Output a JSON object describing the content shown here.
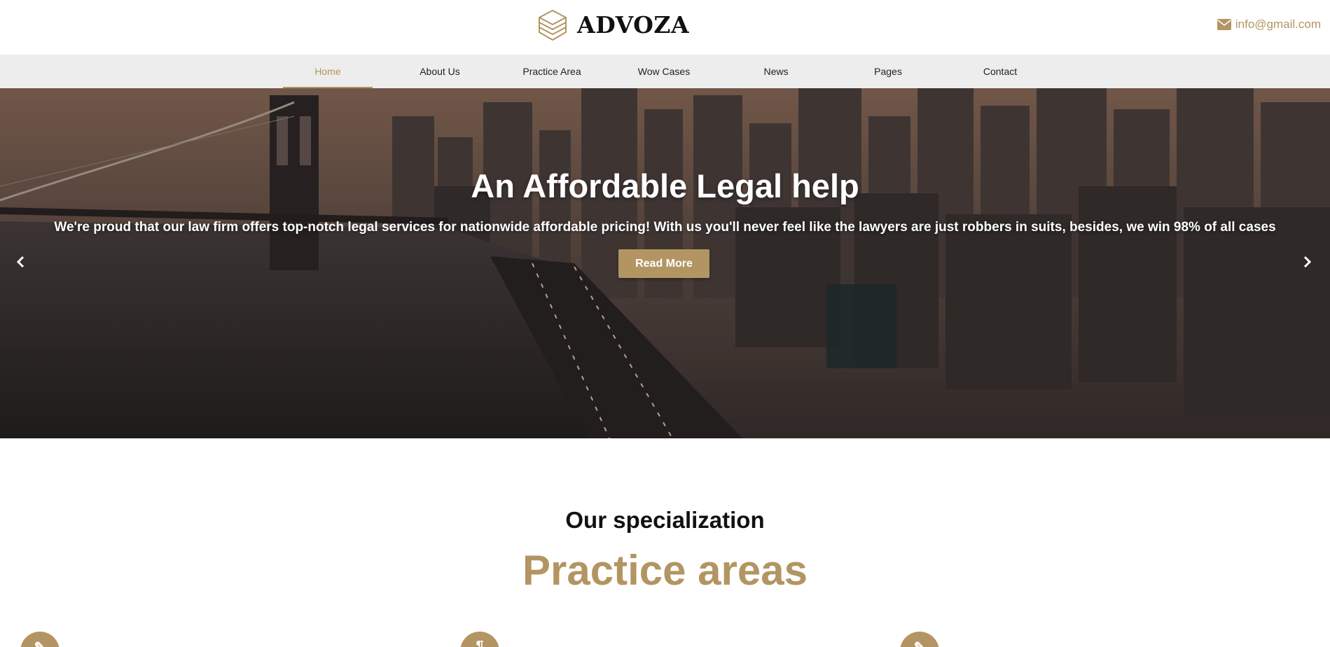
{
  "brand": {
    "name": "ADVOZA",
    "logo_icon": "stacked-layers-icon"
  },
  "header": {
    "email": "info@gmail.com",
    "email_icon": "envelope-icon"
  },
  "nav": {
    "items": [
      {
        "label": "Home",
        "active": true
      },
      {
        "label": "About Us",
        "active": false
      },
      {
        "label": "Practice Area",
        "active": false
      },
      {
        "label": "Wow Cases",
        "active": false
      },
      {
        "label": "News",
        "active": false
      },
      {
        "label": "Pages",
        "active": false
      },
      {
        "label": "Contact",
        "active": false
      }
    ]
  },
  "hero": {
    "title": "An Affordable Legal help",
    "subtitle": "We're proud that our law firm offers top-notch legal services for nationwide affordable pricing! With us you'll never feel like the lawyers are just robbers in suits, besides, we win 98% of all cases",
    "button_label": "Read More",
    "prev_icon": "chevron-left-icon",
    "next_icon": "chevron-right-icon"
  },
  "practice": {
    "eyebrow": "Our specialization",
    "title": "Practice areas"
  },
  "colors": {
    "accent": "#b39563",
    "nav_bg": "#ededed"
  }
}
